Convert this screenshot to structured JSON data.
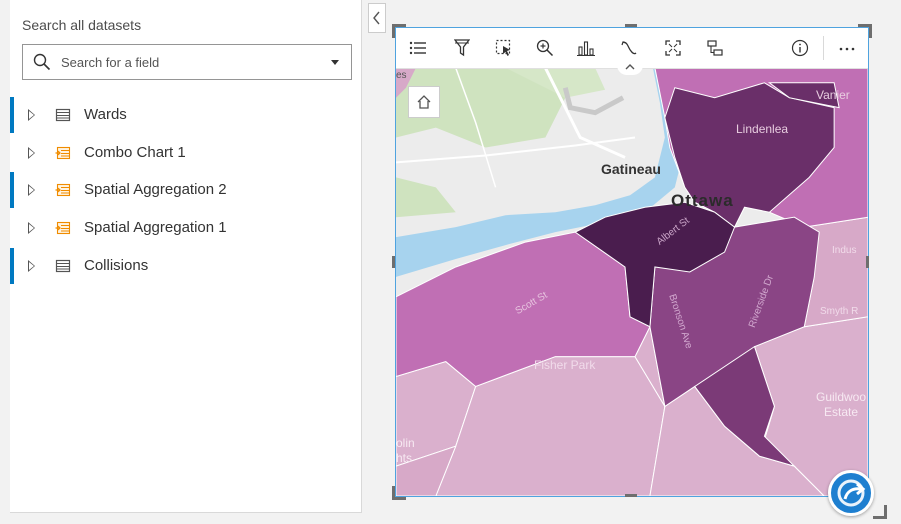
{
  "data_pane": {
    "title": "Search all datasets",
    "search": {
      "placeholder": "Search for a field",
      "value": ""
    },
    "datasets": [
      {
        "label": "Wards",
        "icon": "table-icon",
        "selected": true
      },
      {
        "label": "Combo Chart 1",
        "icon": "result-dataset-icon",
        "selected": false
      },
      {
        "label": "Spatial Aggregation 2",
        "icon": "result-dataset-icon",
        "selected": true
      },
      {
        "label": "Spatial Aggregation 1",
        "icon": "result-dataset-icon",
        "selected": false
      },
      {
        "label": "Collisions",
        "icon": "table-icon",
        "selected": true
      }
    ]
  },
  "card": {
    "toolbar_icons": [
      "legend-icon",
      "filter-icon",
      "select-icon",
      "zoom-icon",
      "visualization-type-icon",
      "flip-card-icon",
      "maximize-icon",
      "layer-options-icon",
      "info-icon",
      "more-icon"
    ],
    "map_labels": {
      "gatineau": "Gatineau",
      "ottawa": "Ottawa",
      "vanier": "Vanier",
      "lindenlea": "Lindenlea",
      "albert_st": "Albert St",
      "scott_st": "Scott St",
      "bronson_ave": "Bronson Ave",
      "riverside_dr": "Riverside Dr",
      "fisher_park": "Fisher Park",
      "smyth_rd": "Smyth R",
      "indus": "Indus",
      "guildwood": "Guildwoo",
      "estate": "Estate",
      "olin": "olin",
      "hts": "hts",
      "es": "es"
    }
  },
  "colors": {
    "accent": "#0079c1",
    "selection_border": "#4fa3df",
    "darkest": "#4a1d4e",
    "dark": "#6a2f69",
    "medium": "#8a4585",
    "light": "#c06fb4",
    "lightest": "#dab0cd",
    "water": "#a7d3ee",
    "park": "#cfe3bf"
  }
}
